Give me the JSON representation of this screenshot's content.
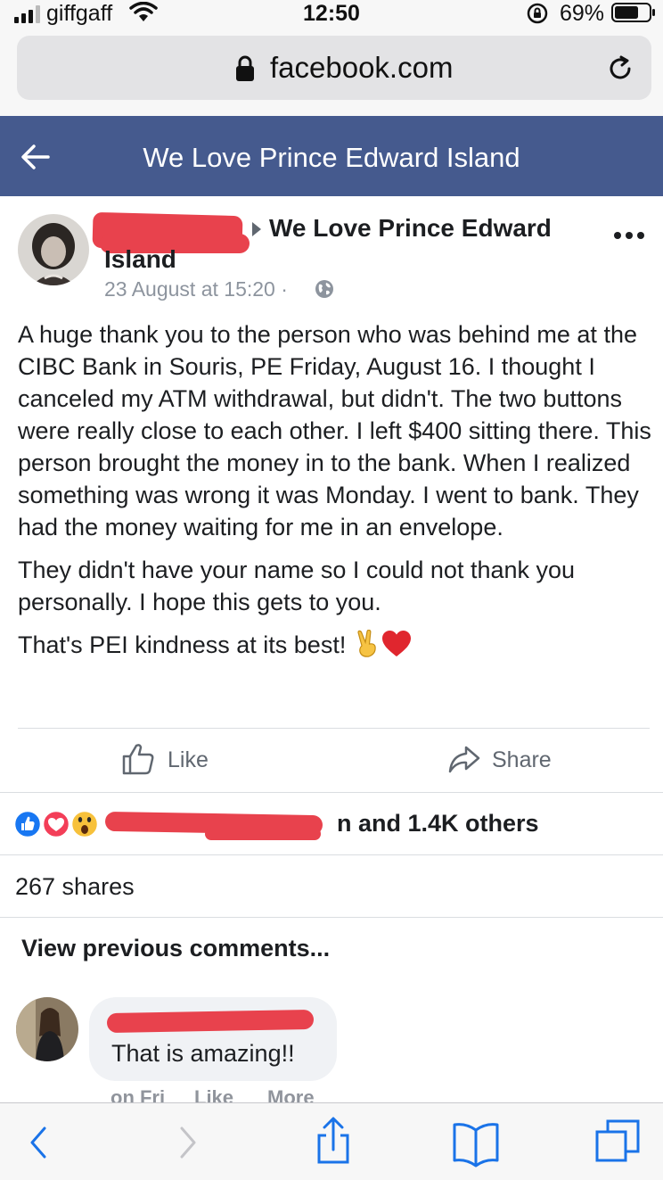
{
  "status_bar": {
    "carrier": "giffgaff",
    "time": "12:50",
    "battery_percent": "69%",
    "battery_level": 0.69,
    "icons": [
      "signal-icon",
      "wifi-icon",
      "rotation-lock-icon",
      "battery-icon"
    ]
  },
  "browser": {
    "url": "facebook.com",
    "icons": [
      "padlock-icon",
      "reload-icon"
    ]
  },
  "header": {
    "title": "We Love Prince Edward Island",
    "color": "#455a8e"
  },
  "post": {
    "group_line1": "We Love Prince Edward",
    "group_line2": "Island",
    "timestamp": "23 August at 15:20 ·",
    "paragraphs": [
      "A huge thank you to the person who was behind me at the CIBC Bank in Souris, PE Friday, August 16. I thought I canceled my ATM withdrawal, but didn't. The two buttons were really close to each other. I left $400 sitting there. This person brought the money in to the bank. When I realized something was wrong it was Monday. I went to bank. They had the money waiting for me in an envelope.",
      "They didn't have your name so I could not thank you personally. I hope this gets to you.",
      "That's PEI kindness at its best!"
    ],
    "like_label": "Like",
    "share_label": "Share",
    "reactions_text": "n and 1.4K others",
    "shares_count": "267 shares",
    "view_previous": "View previous comments...",
    "redaction_color": "#e8424d"
  },
  "comment": {
    "text": "That is amazing!!",
    "meta": [
      "on Fri",
      "Like",
      "More"
    ]
  },
  "toolbar": {
    "icons": [
      "back-icon",
      "forward-icon",
      "share-icon",
      "bookmarks-icon",
      "tabs-icon"
    ],
    "accent": "#1a73e8"
  }
}
